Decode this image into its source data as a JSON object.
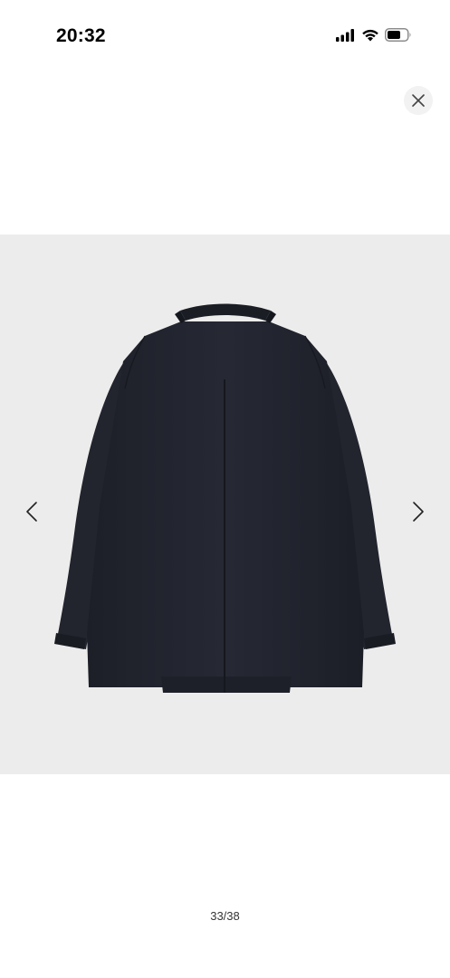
{
  "status_bar": {
    "time": "20:32",
    "icons": [
      "signal-icon",
      "wifi-icon",
      "battery-icon"
    ]
  },
  "viewer": {
    "close_icon": "close-icon",
    "prev_icon": "chevron-left-icon",
    "next_icon": "chevron-right-icon",
    "image": {
      "subject": "product-photo",
      "background_color": "#ececec",
      "garment_color": "#23252f"
    },
    "counter": "33/38"
  }
}
